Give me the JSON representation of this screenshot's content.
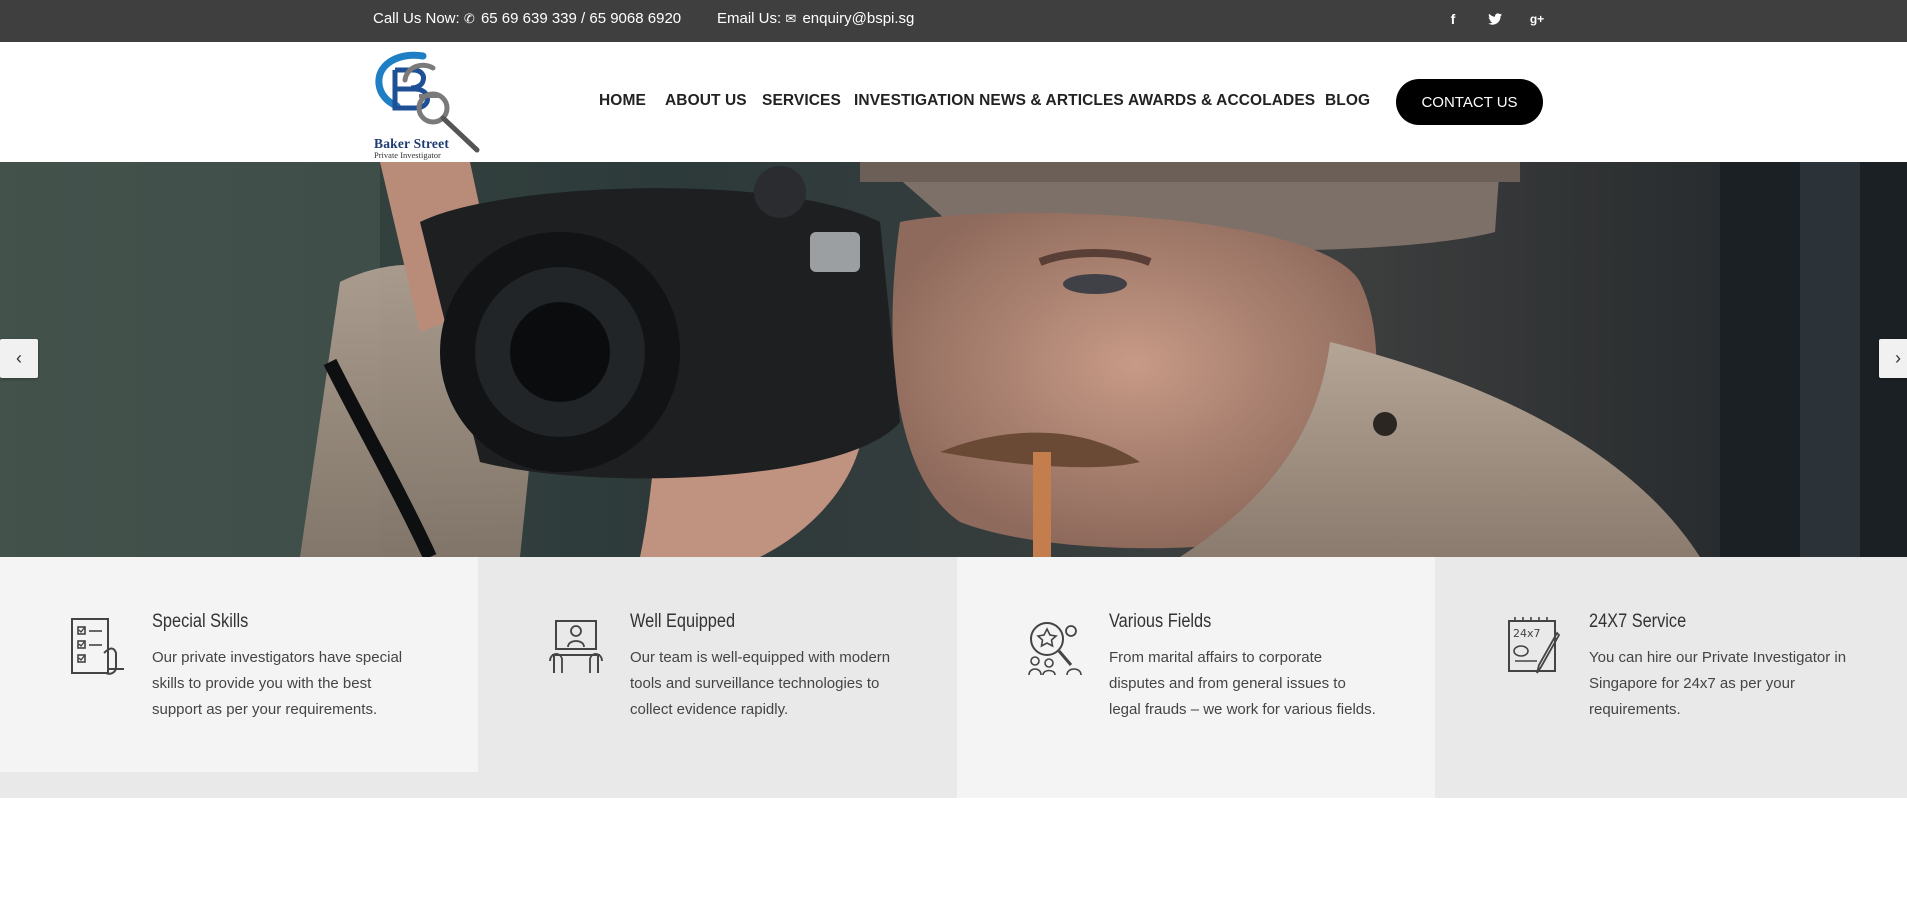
{
  "topbar": {
    "call_label": "Call Us Now:",
    "phones": "65 69 639 339 / 65 9068 6920",
    "email_label": "Email Us:",
    "email": "enquiry@bspi.sg",
    "social": [
      {
        "name": "facebook",
        "glyph": "f"
      },
      {
        "name": "twitter",
        "glyph": "t"
      },
      {
        "name": "google-plus",
        "glyph": "g+"
      }
    ]
  },
  "logo": {
    "name": "Baker Street",
    "subtitle": "Private Investigator"
  },
  "nav": {
    "items": [
      "HOME",
      "ABOUT US",
      "SERVICES",
      "INVESTIGATION NEWS & ARTICLES",
      "AWARDS & ACCOLADES",
      "BLOG"
    ],
    "cta": "CONTACT US"
  },
  "hero": {
    "prev_icon": "chevron-left-icon",
    "next_icon": "chevron-right-icon"
  },
  "features": [
    {
      "icon": "checklist-icon",
      "title": "Special Skills",
      "text": "Our private investigators have special skills to provide you with the best support as per your requirements.",
      "bg": "#f4f4f4"
    },
    {
      "icon": "desk-meeting-icon",
      "title": "Well Equipped",
      "text": "Our team is well-equipped with modern tools and surveillance technologies to collect evidence rapidly.",
      "bg": "#e9e9e9"
    },
    {
      "icon": "search-people-icon",
      "title": "Various Fields",
      "text": "From marital affairs to corporate disputes and from general issues to legal frauds – we work for various fields.",
      "bg": "#f4f4f4"
    },
    {
      "icon": "24x7-notepad-icon",
      "title": "24X7 Service",
      "text": "You can hire our Private Investigator in Singapore for 24x7 as per your requirements.",
      "bg": "#e9e9e9"
    }
  ],
  "colors": {
    "topbar": "#3f3f3f",
    "cta": "#000000",
    "logo_blue": "#1f7fc4",
    "logo_gray": "#7a7a7a"
  }
}
